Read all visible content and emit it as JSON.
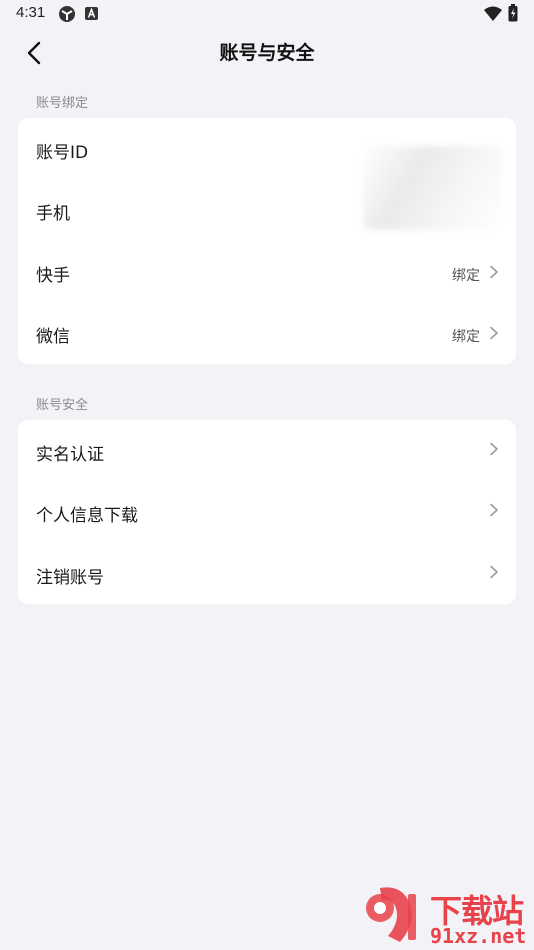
{
  "status_bar": {
    "time": "4:31",
    "icons": [
      "network-globe-icon",
      "app-a-icon",
      "wifi-icon",
      "battery-icon"
    ]
  },
  "header": {
    "title": "账号与安全",
    "back_icon": "chevron-left-icon"
  },
  "sections": [
    {
      "label": "账号绑定",
      "rows": [
        {
          "label": "账号ID",
          "value": "",
          "chevron": false
        },
        {
          "label": "手机",
          "value": "",
          "chevron": false
        },
        {
          "label": "快手",
          "value": "绑定",
          "chevron": true
        },
        {
          "label": "微信",
          "value": "绑定",
          "chevron": true
        }
      ]
    },
    {
      "label": "账号安全",
      "rows": [
        {
          "label": "实名认证",
          "value": "",
          "chevron": true
        },
        {
          "label": "个人信息下载",
          "value": "",
          "chevron": true
        },
        {
          "label": "注销账号",
          "value": "",
          "chevron": true
        }
      ]
    }
  ],
  "watermark": {
    "top": "下载站",
    "bottom": "91xz.net"
  },
  "colors": {
    "background": "#f3f3f7",
    "card": "#ffffff",
    "section_label": "#8a8a92",
    "watermark": "#e8424a"
  }
}
